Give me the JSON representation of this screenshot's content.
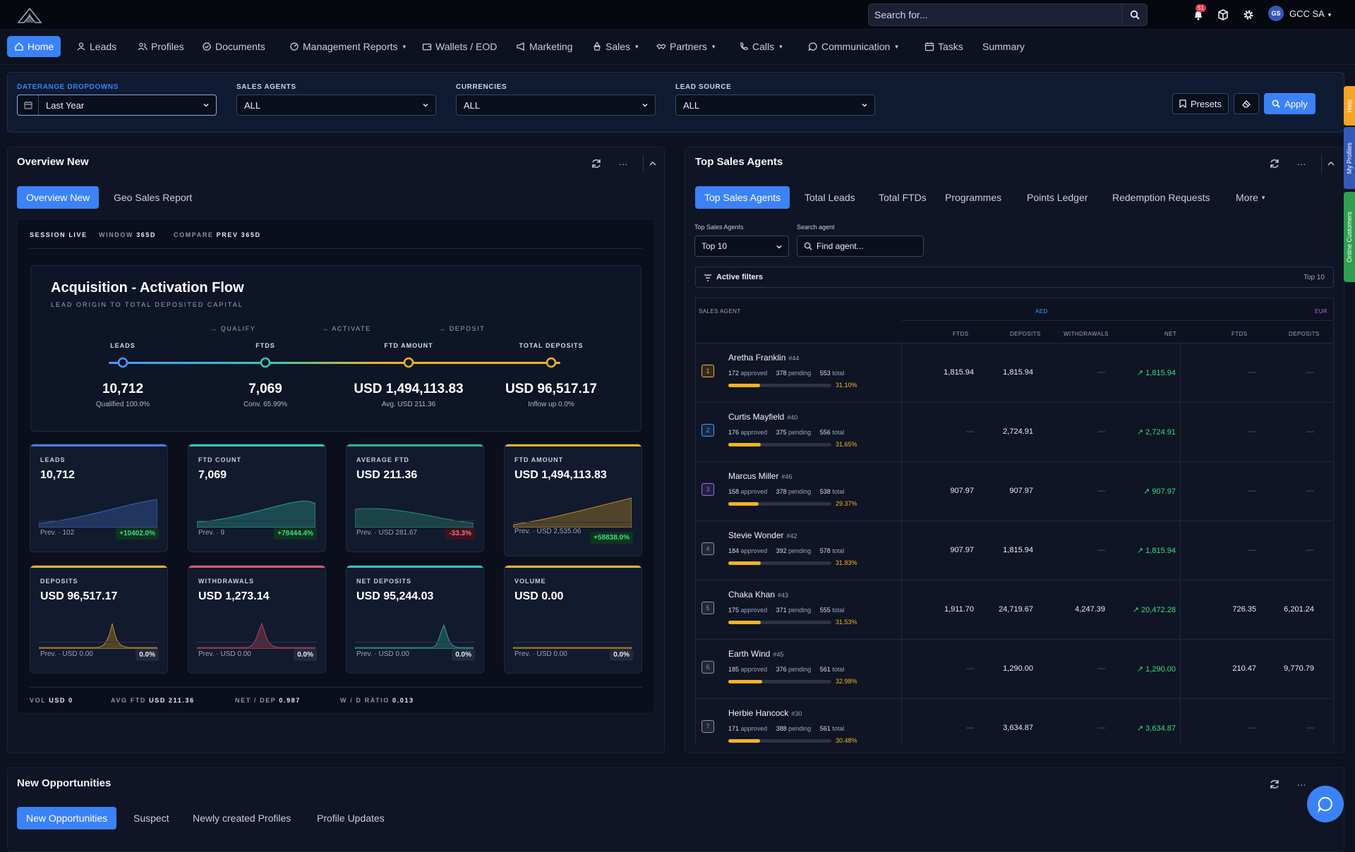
{
  "topbar": {
    "search_placeholder": "Search for...",
    "notification_count": "51",
    "avatar_initials": "GS",
    "org_name": "GCC SA"
  },
  "nav": {
    "items": [
      {
        "label": "Home",
        "icon": "home-icon",
        "active": true
      },
      {
        "label": "Leads",
        "icon": "user-icon"
      },
      {
        "label": "Profiles",
        "icon": "users-icon"
      },
      {
        "label": "Documents",
        "icon": "check-circle-icon"
      },
      {
        "label": "Management Reports",
        "icon": "gauge-icon",
        "dropdown": true
      },
      {
        "label": "Wallets / EOD",
        "icon": "wallet-icon"
      },
      {
        "label": "Marketing",
        "icon": "megaphone-icon"
      },
      {
        "label": "Sales",
        "icon": "sales-icon",
        "dropdown": true
      },
      {
        "label": "Partners",
        "icon": "handshake-icon",
        "dropdown": true
      },
      {
        "label": "Calls",
        "icon": "phone-icon",
        "dropdown": true
      },
      {
        "label": "Communication",
        "icon": "chat-icon",
        "dropdown": true
      },
      {
        "label": "Tasks",
        "icon": "calendar-icon"
      },
      {
        "label": "Summary",
        "icon": ""
      }
    ]
  },
  "filters": {
    "daterange_label": "DATERANGE DROPDOWNS",
    "daterange_value": "Last Year",
    "agents_label": "SALES AGENTS",
    "agents_value": "ALL",
    "currencies_label": "CURRENCIES",
    "currencies_value": "ALL",
    "source_label": "LEAD SOURCE",
    "source_value": "ALL",
    "presets_label": "Presets",
    "apply_label": "Apply"
  },
  "overview": {
    "title": "Overview New",
    "tabs": [
      "Overview New",
      "Geo Sales Report"
    ],
    "session": {
      "live": "SESSION LIVE",
      "window_label": "WINDOW",
      "window_value": "365D",
      "compare_label": "COMPARE",
      "compare_value": "PREV 365D"
    },
    "flow": {
      "title": "Acquisition - Activation Flow",
      "subtitle": "LEAD ORIGIN TO TOTAL DEPOSITED CAPITAL",
      "steps": [
        "→ QUALIFY",
        "→ ACTIVATE",
        "→ DEPOSIT"
      ],
      "nodes": [
        {
          "label": "LEADS",
          "value": "10,712",
          "sub": "Qualified 100.0%",
          "color": "#4a9bff"
        },
        {
          "label": "FTDS",
          "value": "7,069",
          "sub": "Conv. 65.99%",
          "color": "#36c9b6"
        },
        {
          "label": "FTD AMOUNT",
          "value": "USD 1,494,113.83",
          "sub": "Avg. USD 211.36",
          "color": "#f5b324"
        },
        {
          "label": "TOTAL DEPOSITS",
          "value": "USD 96,517.17",
          "sub": "Inflow up 0.0%",
          "color": "#f5b324"
        }
      ]
    },
    "kpis": [
      {
        "label": "LEADS",
        "value": "10,712",
        "prev": "Prev. · 102",
        "change": "+10402.0%",
        "tone": "g",
        "color": "#4a7fe0"
      },
      {
        "label": "FTD COUNT",
        "value": "7,069",
        "prev": "Prev. · 9",
        "change": "+78444.4%",
        "tone": "g",
        "color": "#36c9b6"
      },
      {
        "label": "AVERAGE FTD",
        "value": "USD 211.36",
        "prev": "Prev. · USD 281.67",
        "change": "-33.3%",
        "tone": "r",
        "color": "#2fb38f"
      },
      {
        "label": "FTD AMOUNT",
        "value": "USD 1,494,113.83",
        "prev": "Prev. · USD 2,535.06",
        "change": "+58838.0%",
        "tone": "g",
        "color": "#f5b324"
      },
      {
        "label": "DEPOSITS",
        "value": "USD 96,517.17",
        "prev": "Prev. · USD 0.00",
        "change": "0.0%",
        "tone": "n",
        "color": "#f5b324"
      },
      {
        "label": "WITHDRAWALS",
        "value": "USD 1,273.14",
        "prev": "Prev. · USD 0.00",
        "change": "0.0%",
        "tone": "n",
        "color": "#e8536d"
      },
      {
        "label": "NET DEPOSITS",
        "value": "USD 95,244.03",
        "prev": "Prev. · USD 0.00",
        "change": "0.0%",
        "tone": "n",
        "color": "#36c9b6"
      },
      {
        "label": "VOLUME",
        "value": "USD 0.00",
        "prev": "Prev. · USD 0.00",
        "change": "0.0%",
        "tone": "n",
        "color": "#f5b324"
      }
    ],
    "footer": [
      {
        "label": "VOL",
        "value": "USD 0"
      },
      {
        "label": "AVG FTD",
        "value": "USD 211.36"
      },
      {
        "label": "NET / DEP",
        "value": "0.987"
      },
      {
        "label": "W / D RATIO",
        "value": "0.013"
      }
    ]
  },
  "agents": {
    "title": "Top Sales Agents",
    "tabs": [
      "Top Sales Agents",
      "Total Leads",
      "Total FTDs",
      "Programmes",
      "Points Ledger",
      "Redemption Requests",
      "More"
    ],
    "top_label": "Top Sales Agents",
    "top_value": "Top 10",
    "search_label": "Search agent",
    "search_placeholder": "Find agent...",
    "active_filters": "Active filters",
    "active_filters_value": "Top 10",
    "headers": {
      "agent": "SALES AGENT",
      "aed": "AED",
      "eur": "EUR",
      "ftds": "FTDS",
      "deposits": "DEPOSITS",
      "withdrawals": "WITHDRAWALS",
      "net": "NET",
      "eur_ftds": "FTDS",
      "eur_deposits": "DEPOSITS"
    },
    "rows": [
      {
        "rank": "1",
        "name": "Aretha Franklin",
        "id": "#44",
        "approved": "172",
        "pending": "378",
        "total": "553",
        "pct": "31.10%",
        "pct_value": 0.311,
        "ftds": "1,815.94",
        "deposits": "1,815.94",
        "withdrawals": "—",
        "net": "↗ 1,815.94",
        "eur_ftds": "—",
        "eur_deposits": "—",
        "rank_color": "#f5b324"
      },
      {
        "rank": "2",
        "name": "Curtis Mayfield",
        "id": "#40",
        "approved": "176",
        "pending": "375",
        "total": "556",
        "pct": "31.65%",
        "pct_value": 0.3165,
        "ftds": "—",
        "deposits": "2,724.91",
        "withdrawals": "—",
        "net": "↗ 2,724.91",
        "eur_ftds": "—",
        "eur_deposits": "—",
        "rank_color": "#4a9bff"
      },
      {
        "rank": "3",
        "name": "Marcus Miller",
        "id": "#46",
        "approved": "158",
        "pending": "378",
        "total": "538",
        "pct": "29.37%",
        "pct_value": 0.2937,
        "ftds": "907.97",
        "deposits": "907.97",
        "withdrawals": "—",
        "net": "↗ 907.97",
        "eur_ftds": "—",
        "eur_deposits": "—",
        "rank_color": "#a16cf0"
      },
      {
        "rank": "4",
        "name": "Stevie Wonder",
        "id": "#42",
        "approved": "184",
        "pending": "392",
        "total": "578",
        "pct": "31.83%",
        "pct_value": 0.3183,
        "ftds": "907.97",
        "deposits": "1,815.94",
        "withdrawals": "—",
        "net": "↗ 1,815.94",
        "eur_ftds": "—",
        "eur_deposits": "—",
        "rank_color": "#8a93a8"
      },
      {
        "rank": "5",
        "name": "Chaka Khan",
        "id": "#43",
        "approved": "175",
        "pending": "371",
        "total": "555",
        "pct": "31.53%",
        "pct_value": 0.3153,
        "ftds": "1,911.70",
        "deposits": "24,719.67",
        "withdrawals": "4,247.39",
        "net": "↗ 20,472.28",
        "eur_ftds": "726.35",
        "eur_deposits": "6,201.24",
        "rank_color": "#8a93a8"
      },
      {
        "rank": "6",
        "name": "Earth Wind",
        "id": "#45",
        "approved": "185",
        "pending": "376",
        "total": "561",
        "pct": "32.98%",
        "pct_value": 0.3298,
        "ftds": "—",
        "deposits": "1,290.00",
        "withdrawals": "—",
        "net": "↗ 1,290.00",
        "eur_ftds": "210.47",
        "eur_deposits": "9,770.79",
        "rank_color": "#8a93a8"
      },
      {
        "rank": "7",
        "name": "Herbie Hancock",
        "id": "#30",
        "approved": "171",
        "pending": "388",
        "total": "561",
        "pct": "30.48%",
        "pct_value": 0.3048,
        "ftds": "—",
        "deposits": "3,634.87",
        "withdrawals": "—",
        "net": "↗ 3,634.87",
        "eur_ftds": "—",
        "eur_deposits": "—",
        "rank_color": "#8a93a8"
      }
    ],
    "approved_word": "approved",
    "pending_word": "pending",
    "total_word": "total"
  },
  "opportunities": {
    "title": "New Opportunities",
    "tabs": [
      "New Opportunities",
      "Suspect",
      "Newly created Profiles",
      "Profile Updates"
    ]
  },
  "rail": [
    "Help",
    "My Profiles",
    "Online Customers"
  ],
  "colors": {
    "accent": "#3b82f6",
    "positive": "#3ddc84",
    "negative": "#ff6b7e",
    "gold": "#f5b324"
  }
}
